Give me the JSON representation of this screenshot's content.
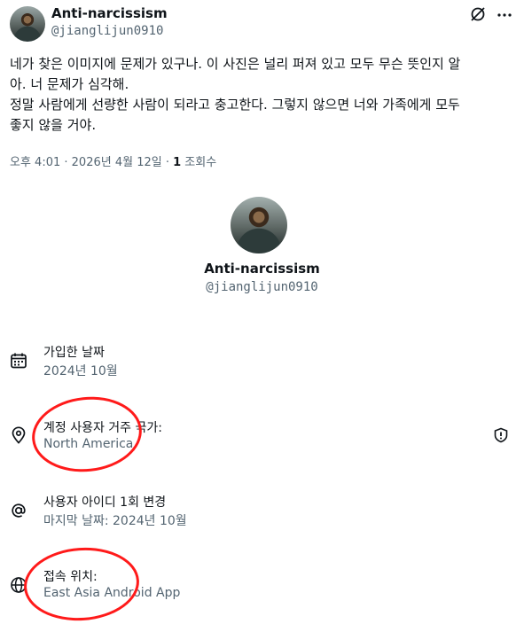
{
  "author": {
    "name": "Anti-narcissism",
    "handle": "@jianglijun0910"
  },
  "tweet": {
    "line1": "네가 찾은 이미지에 문제가 있구나. 이 사진은 널리 퍼져 있고 모두 무슨 뜻인지 알",
    "line2": "아. 너 문제가 심각해.",
    "line3": "정말 사람에게 선량한 사람이 되라고 충고한다. 그렇지 않으면 너와 가족에게 모두",
    "line4": "좋지 않을 거야."
  },
  "meta": {
    "time": "오후 4:01",
    "sep": " · ",
    "date": "2026년 4월 12일",
    "sep2": " · ",
    "views": "1",
    "views_label": " 조회수"
  },
  "card": {
    "name": "Anti-narcissism",
    "handle": "@jianglijun0910"
  },
  "rows": [
    {
      "label": "가입한 날짜",
      "value": "2024년 10월",
      "icon": "calendar-icon"
    },
    {
      "label": "계정 사용자 거주 국가:",
      "value": "North America",
      "icon": "location-pin-icon"
    },
    {
      "label": "사용자 아이디 1회 변경",
      "value": "마지막 날짜: 2024년 10월",
      "icon": "at-sign-icon"
    },
    {
      "label": "접속 위치:",
      "value": "East Asia Android App",
      "icon": "globe-icon"
    }
  ],
  "annotation_color": "#ff1a1a"
}
